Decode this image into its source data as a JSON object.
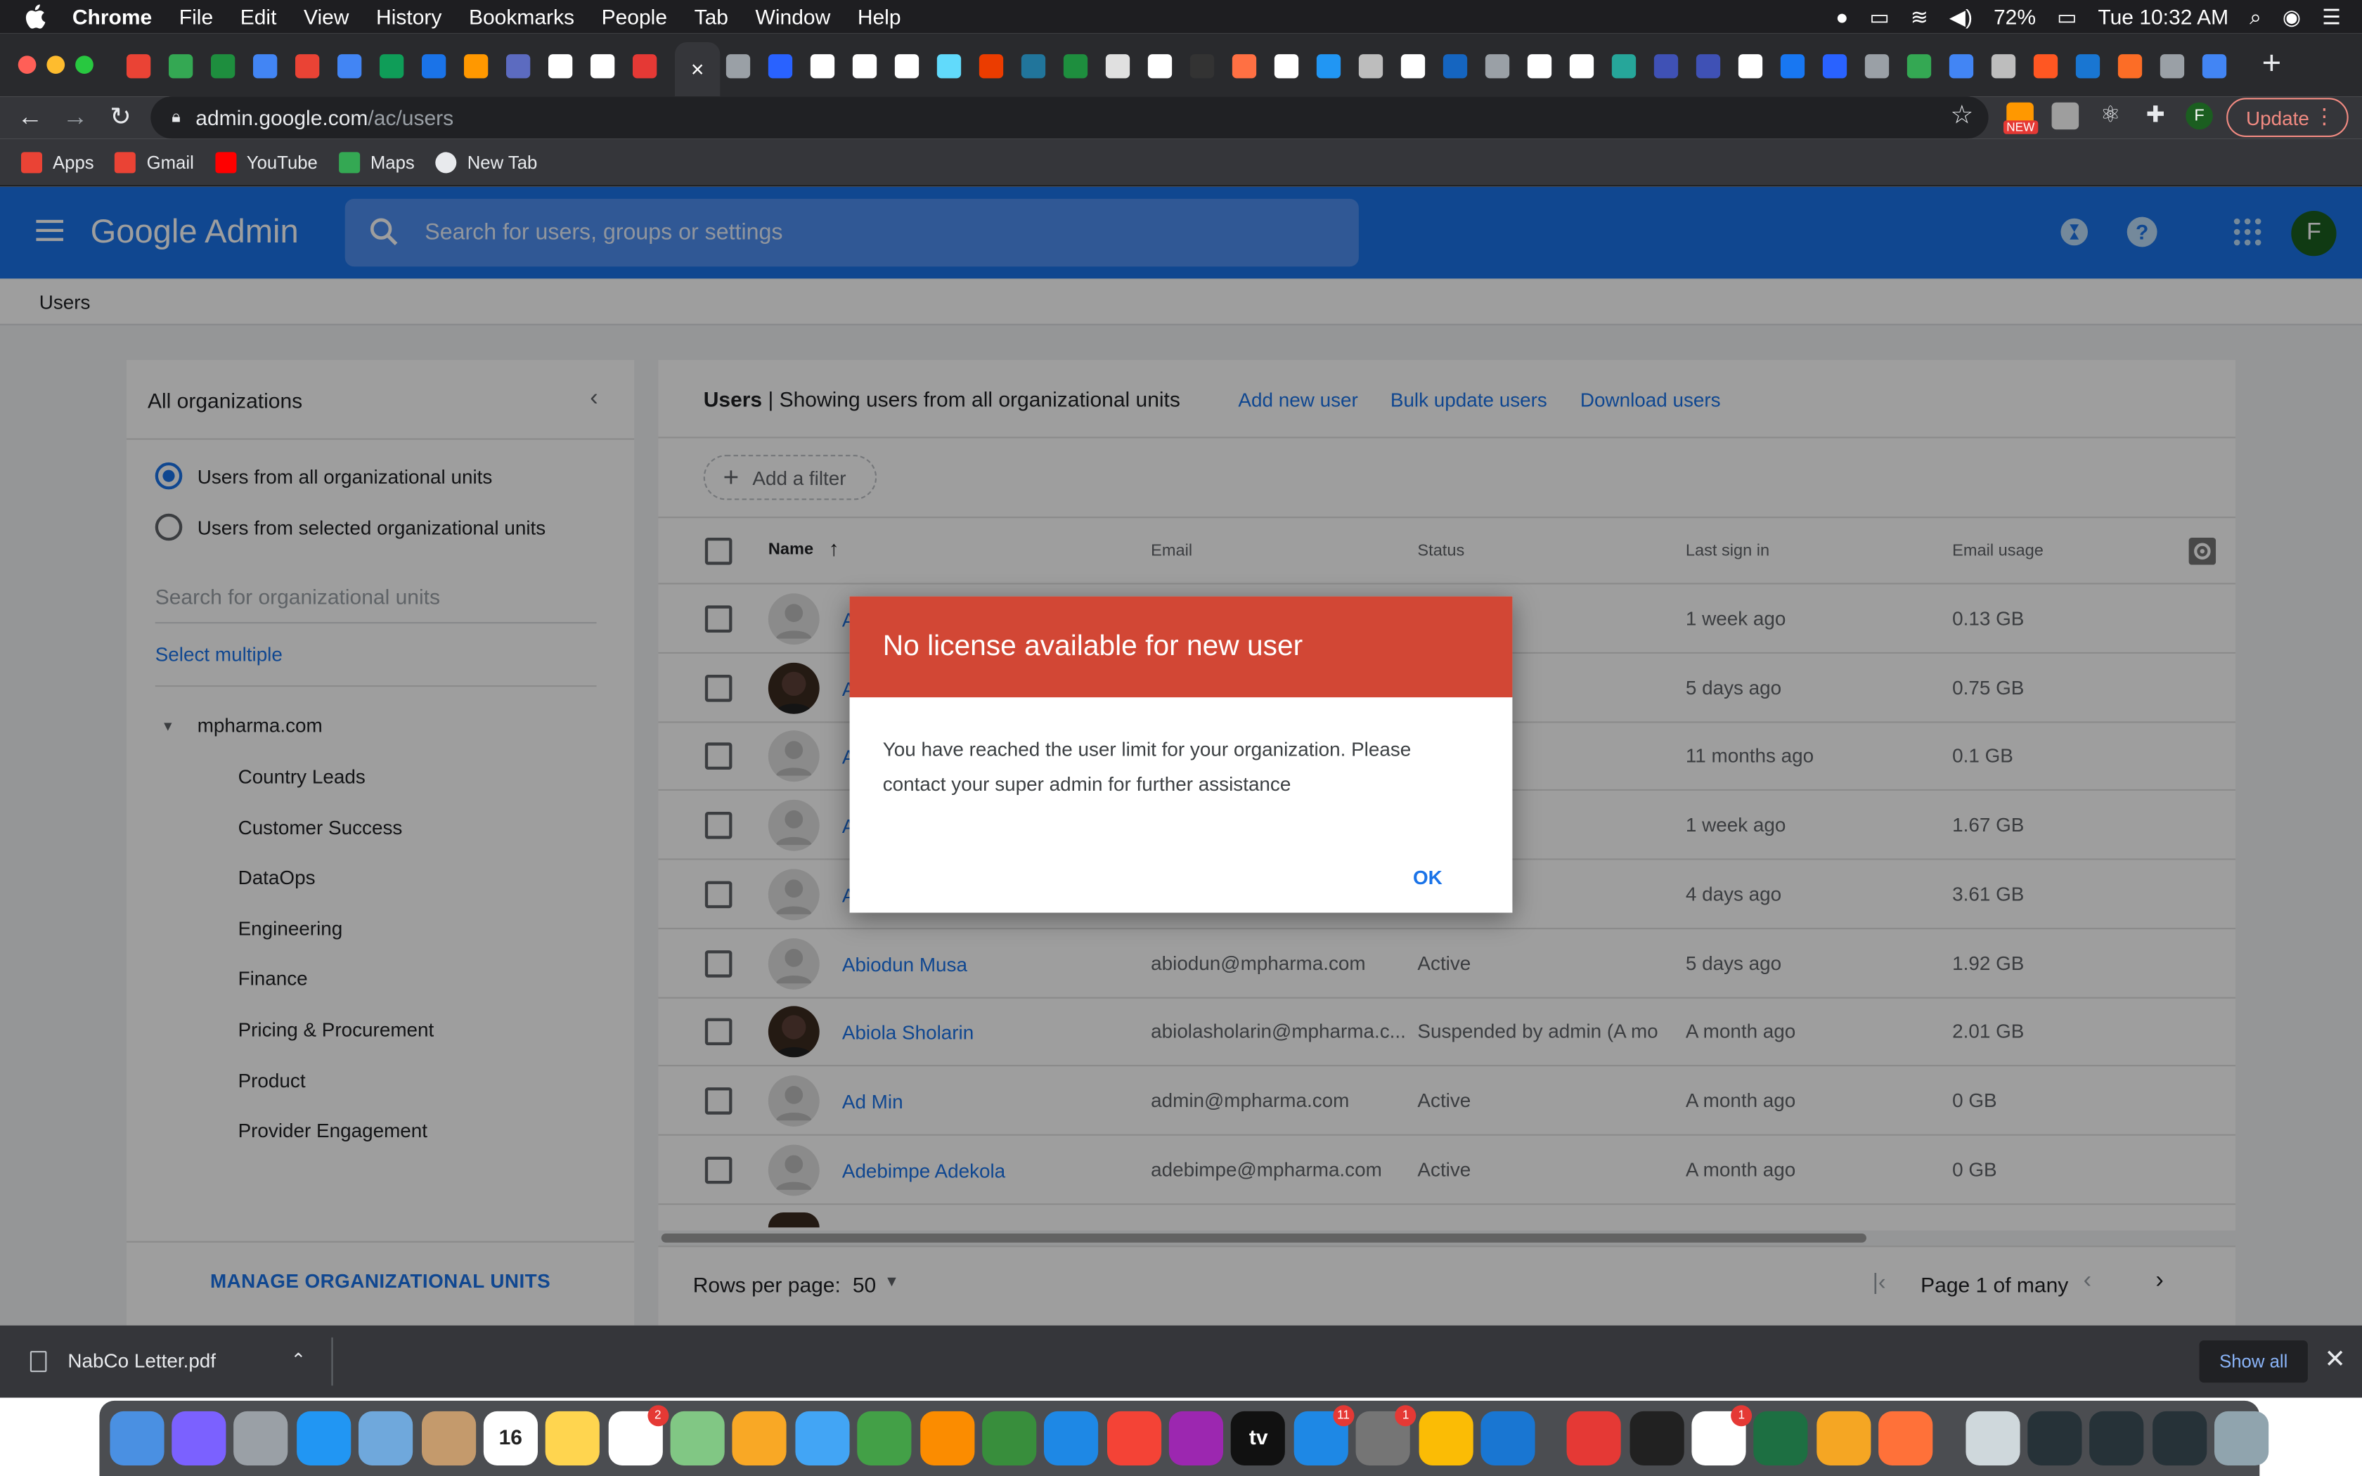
{
  "menubar": {
    "app_name": "Chrome",
    "items": [
      "File",
      "Edit",
      "View",
      "History",
      "Bookmarks",
      "People",
      "Tab",
      "Window",
      "Help"
    ],
    "battery": "72%",
    "clock": "Tue 10:32 AM"
  },
  "browser": {
    "url_host": "admin.google.com",
    "url_path": "/ac/users",
    "active_tab_glyph": "×",
    "update_label": "Update",
    "profile_initial": "F",
    "ext_badge": "NEW",
    "tab_favicon_colors": [
      "#ea4335",
      "#34a853",
      "#1e8e3e",
      "#4285f4",
      "#ea4335",
      "#4285f4",
      "#0f9d58",
      "#1a73e8",
      "#ff9800",
      "#5c6bc0",
      "#ffffff",
      "#ffffff",
      "#e53935",
      "#9aa0a6",
      "#2962ff",
      "#ffffff",
      "#ffffff",
      "#ffffff",
      "#61dafb",
      "#eb3c00",
      "#21759b",
      "#1e8e3e",
      "#e0e0e0",
      "#ffffff",
      "#333333",
      "#ff7043",
      "#ffffff",
      "#2196f3",
      "#bdbdbd",
      "#ffffff",
      "#1565c0",
      "#9aa0a6",
      "#ffffff",
      "#ffffff",
      "#26a69a",
      "#3f51b5",
      "#3f51b5",
      "#ffffff",
      "#1877f2",
      "#2962ff",
      "#9aa0a6",
      "#34a853",
      "#4285f4",
      "#bdbdbd",
      "#ff5722",
      "#1976d2",
      "#fc6d26",
      "#9aa0a6",
      "#4285f4"
    ]
  },
  "bookmarks": [
    {
      "label": "Apps",
      "icon": "apps-grid-icon",
      "color": "#ea4335"
    },
    {
      "label": "Gmail",
      "icon": "gmail-icon",
      "color": "#ea4335"
    },
    {
      "label": "YouTube",
      "icon": "youtube-icon",
      "color": "#ff0000"
    },
    {
      "label": "Maps",
      "icon": "maps-icon",
      "color": "#34a853"
    },
    {
      "label": "New Tab",
      "icon": "globe-icon",
      "color": "#e8eaed"
    }
  ],
  "admin": {
    "logo": "Google Admin",
    "search_placeholder": "Search for users, groups or settings",
    "avatar_initial": "F",
    "breadcrumb": "Users"
  },
  "org_panel": {
    "title": "All organizations",
    "radio_all": "Users from all organizational units",
    "radio_selected": "Users from selected organizational units",
    "search_placeholder": "Search for organizational units",
    "select_multiple": "Select multiple",
    "root": "mpharma.com",
    "children": [
      "Country Leads",
      "Customer Success",
      "DataOps",
      "Engineering",
      "Finance",
      "Pricing & Procurement",
      "Product",
      "Provider Engagement"
    ],
    "manage": "MANAGE ORGANIZATIONAL UNITS"
  },
  "users_panel": {
    "title_bold": "Users",
    "title_rest": " | Showing users from all organizational units",
    "links": [
      "Add new user",
      "Bulk update users",
      "Download users"
    ],
    "filter": "Add a filter",
    "columns": [
      "Name",
      "Email",
      "Status",
      "Last sign in",
      "Email usage"
    ],
    "rows": [
      {
        "name": "A",
        "email": "",
        "status": "",
        "last": "1 week ago",
        "usage": "0.13 GB",
        "photo": false
      },
      {
        "name": "A",
        "email": "",
        "status": "",
        "last": "5 days ago",
        "usage": "0.75 GB",
        "photo": true
      },
      {
        "name": "A",
        "email": "",
        "status": "",
        "last": "11 months ago",
        "usage": "0.1 GB",
        "photo": false
      },
      {
        "name": "A",
        "email": "",
        "status": "",
        "last": "1 week ago",
        "usage": "1.67 GB",
        "photo": false
      },
      {
        "name": "A",
        "email": "",
        "status": "",
        "last": "4 days ago",
        "usage": "3.61 GB",
        "photo": false
      },
      {
        "name": "Abiodun Musa",
        "email": "abiodun@mpharma.com",
        "status": "Active",
        "last": "5 days ago",
        "usage": "1.92 GB",
        "photo": false
      },
      {
        "name": "Abiola Sholarin",
        "email": "abiolasholarin@mpharma.c...",
        "status": "Suspended by admin (A mo...",
        "last": "A month ago",
        "usage": "2.01 GB",
        "photo": true
      },
      {
        "name": "Ad Min",
        "email": "admin@mpharma.com",
        "status": "Active",
        "last": "A month ago",
        "usage": "0 GB",
        "photo": false
      },
      {
        "name": "Adebimpe Adekola",
        "email": "adebimpe@mpharma.com",
        "status": "Active",
        "last": "A month ago",
        "usage": "0 GB",
        "photo": false
      }
    ],
    "rows_per_page_label": "Rows per page:",
    "rows_per_page": "50",
    "page_info": "Page 1 of many"
  },
  "dialog": {
    "title": "No license available for new user",
    "body": "You have reached the user limit for your organization. Please contact your super admin for further assistance",
    "ok": "OK"
  },
  "download_bar": {
    "file": "NabCo Letter.pdf",
    "show_all": "Show all"
  },
  "dock": {
    "apps": [
      {
        "name": "finder-icon",
        "color": "#4a90e2"
      },
      {
        "name": "siri-icon",
        "color": "#7b61ff"
      },
      {
        "name": "launchpad-icon",
        "color": "#9aa0a6"
      },
      {
        "name": "safari-icon",
        "color": "#2196f3"
      },
      {
        "name": "mail-icon",
        "color": "#6fa8dc"
      },
      {
        "name": "contacts-icon",
        "color": "#c49a6c"
      },
      {
        "name": "calendar-icon",
        "color": "#ffffff",
        "label": "16"
      },
      {
        "name": "notes-icon",
        "color": "#ffd54f"
      },
      {
        "name": "reminders-icon",
        "color": "#ffffff",
        "badge": "2"
      },
      {
        "name": "maps-icon",
        "color": "#81c784"
      },
      {
        "name": "photos-icon",
        "color": "#f9a825"
      },
      {
        "name": "messages-icon",
        "color": "#42a5f5"
      },
      {
        "name": "facetime-icon",
        "color": "#43a047"
      },
      {
        "name": "pages-icon",
        "color": "#fb8c00"
      },
      {
        "name": "numbers-icon",
        "color": "#388e3c"
      },
      {
        "name": "keynote-icon",
        "color": "#1e88e5"
      },
      {
        "name": "music-icon",
        "color": "#f44336"
      },
      {
        "name": "podcasts-icon",
        "color": "#9c27b0"
      },
      {
        "name": "apple-tv-icon",
        "color": "#111111",
        "label": "tv"
      },
      {
        "name": "app-store-icon",
        "color": "#1e88e5",
        "badge": "11"
      },
      {
        "name": "system-preferences-icon",
        "color": "#757575",
        "badge": "1"
      },
      {
        "name": "chrome-icon",
        "color": "#fbbc05"
      },
      {
        "name": "vscode-icon",
        "color": "#1976d2"
      },
      {
        "name": "sep"
      },
      {
        "name": "git-icon",
        "color": "#e53935"
      },
      {
        "name": "terminal-icon",
        "color": "#212121"
      },
      {
        "name": "slack-icon",
        "color": "#ffffff",
        "badge": "1"
      },
      {
        "name": "excel-icon",
        "color": "#1d6f42"
      },
      {
        "name": "vpn-icon",
        "color": "#f5a623"
      },
      {
        "name": "firefox-icon",
        "color": "#ff7139"
      },
      {
        "name": "sep"
      },
      {
        "name": "files-icon",
        "color": "#cfd8dc"
      },
      {
        "name": "window-thumb-icon",
        "color": "#263238"
      },
      {
        "name": "window-thumb-icon",
        "color": "#263238"
      },
      {
        "name": "window-thumb-icon",
        "color": "#263238"
      },
      {
        "name": "trash-icon",
        "color": "#90a4ae"
      }
    ]
  }
}
